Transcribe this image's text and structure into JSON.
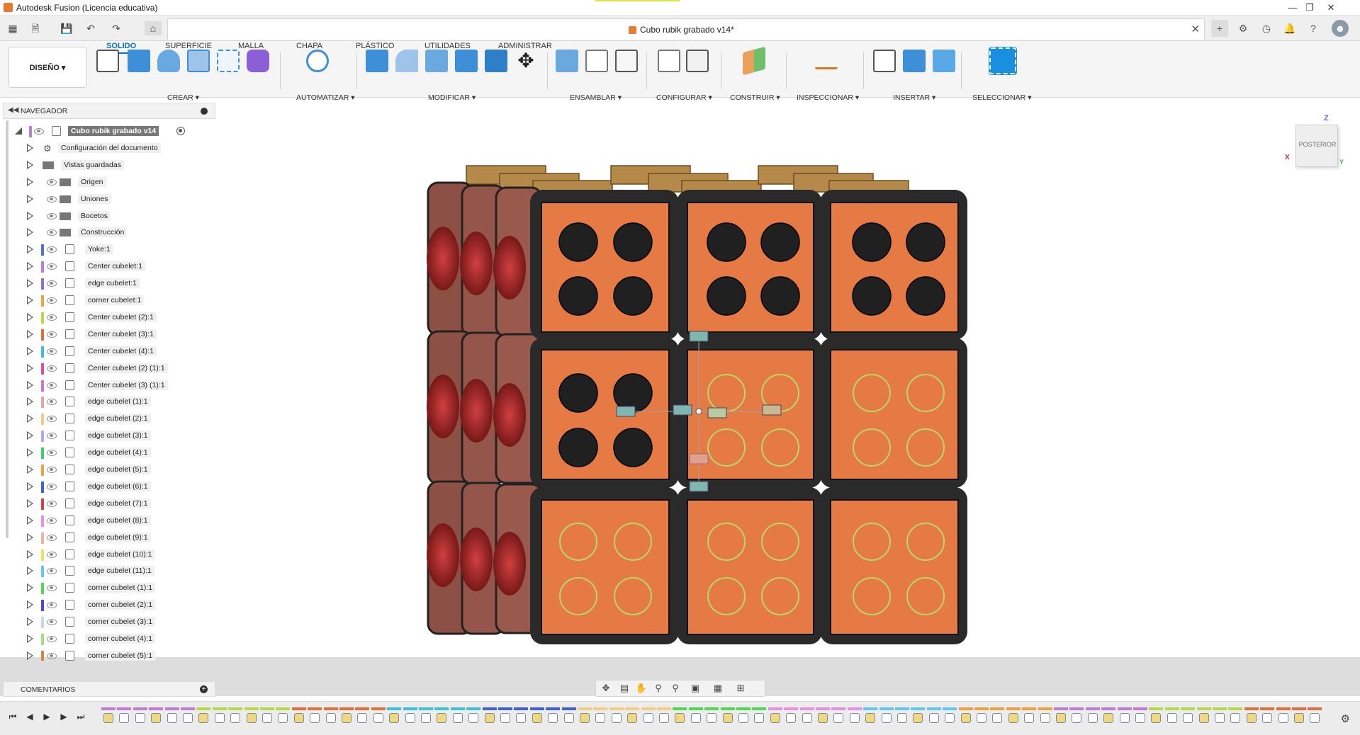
{
  "app": {
    "title": "Autodesk Fusion (Licencia educativa)"
  },
  "document": {
    "tab_title": "Cubo rubik grabado v14*"
  },
  "ribbon": {
    "tabs": [
      "SOLIDO",
      "SUPERFICIE",
      "MALLA",
      "CHAPA",
      "PLÁSTICO",
      "UTILIDADES",
      "ADMINISTRAR"
    ],
    "active_tab": "SOLIDO",
    "workspace": "DISEÑO",
    "groups": [
      "CREAR",
      "AUTOMATIZAR",
      "MODIFICAR",
      "ENSAMBLAR",
      "CONFIGURAR",
      "CONSTRUIR",
      "INSPECCIONAR",
      "INSERTAR",
      "SELECCIONAR"
    ]
  },
  "navigator": {
    "header": "NAVEGADOR",
    "root": "Cubo rubik grabado v14",
    "items": [
      {
        "label": "Configuración del documento",
        "type": "settings",
        "color": ""
      },
      {
        "label": "Vistas guardadas",
        "type": "folder-plain",
        "color": ""
      },
      {
        "label": "Origen",
        "type": "folder",
        "color": ""
      },
      {
        "label": "Uniones",
        "type": "folder",
        "color": ""
      },
      {
        "label": "Bocetos",
        "type": "folder",
        "color": ""
      },
      {
        "label": "Construcción",
        "type": "folder",
        "color": ""
      },
      {
        "label": "Yoke:1",
        "type": "component",
        "color": "#4a72d8"
      },
      {
        "label": "Center cubelet:1",
        "type": "component",
        "color": "#c07ad8"
      },
      {
        "label": "edge cubelet:1",
        "type": "component",
        "color": "#8f6fd8"
      },
      {
        "label": "corner cubelet:1",
        "type": "component",
        "color": "#f0a040"
      },
      {
        "label": "Center cubelet (2):1",
        "type": "component",
        "color": "#b8d84a"
      },
      {
        "label": "Center cubelet (3):1",
        "type": "component",
        "color": "#e0713a"
      },
      {
        "label": "Center cubelet (4):1",
        "type": "component",
        "color": "#3cc3d8"
      },
      {
        "label": "Center cubelet (2) (1):1",
        "type": "component",
        "color": "#e04aa0"
      },
      {
        "label": "Center cubelet (3) (1):1",
        "type": "component",
        "color": "#d070d8"
      },
      {
        "label": "edge cubelet (1):1",
        "type": "component",
        "color": "#f0a0a0"
      },
      {
        "label": "edge cubelet (2):1",
        "type": "component",
        "color": "#f0d080"
      },
      {
        "label": "edge cubelet (3):1",
        "type": "component",
        "color": "#c0a0e8"
      },
      {
        "label": "edge cubelet (4):1",
        "type": "component",
        "color": "#3ad070"
      },
      {
        "label": "edge cubelet (5):1",
        "type": "component",
        "color": "#f0a040"
      },
      {
        "label": "edge cubelet (6):1",
        "type": "component",
        "color": "#4060d8"
      },
      {
        "label": "edge cubelet (7):1",
        "type": "component",
        "color": "#d84040"
      },
      {
        "label": "edge cubelet (8):1",
        "type": "component",
        "color": "#e890e0"
      },
      {
        "label": "edge cubelet (9):1",
        "type": "component",
        "color": "#f0b0a0"
      },
      {
        "label": "edge cubelet (10):1",
        "type": "component",
        "color": "#f0e060"
      },
      {
        "label": "edge cubelet (11):1",
        "type": "component",
        "color": "#60c8f0"
      },
      {
        "label": "corner cubelet (1):1",
        "type": "component",
        "color": "#50d850"
      },
      {
        "label": "corner cubelet (2):1",
        "type": "component",
        "color": "#6040d0"
      },
      {
        "label": "corner cubelet (3):1",
        "type": "component",
        "color": "#c0d8f0"
      },
      {
        "label": "corner cubelet (4):1",
        "type": "component",
        "color": "#a0e080"
      },
      {
        "label": "corner cubelet (5):1",
        "type": "component",
        "color": "#e08040"
      }
    ]
  },
  "comments": {
    "header": "COMENTARIOS"
  },
  "viewcube": {
    "face": "POSTERIOR",
    "z_label": "Z",
    "x_label": "X",
    "y_label": "Y"
  },
  "colors": {
    "accent": "#0b6fc5",
    "face_orange": "#e57a45",
    "tile_black": "#1e1e1e",
    "ring_green": "#b8d66a"
  },
  "icons": {
    "quick_access": [
      "grid-icon",
      "file-icon",
      "save-icon",
      "undo-icon",
      "redo-icon",
      "home-icon"
    ],
    "right_header": [
      "new-tab-icon",
      "extensions-icon",
      "job-status-icon",
      "notifications-icon",
      "help-icon",
      "profile-icon"
    ],
    "nav_bar": [
      "orbit-icon",
      "look-at-icon",
      "pan-icon",
      "zoom-icon",
      "fit-icon",
      "display-settings-icon",
      "grid-settings-icon",
      "viewports-icon"
    ],
    "timeline": [
      "go-start-icon",
      "step-back-icon",
      "play-icon",
      "step-forward-icon",
      "go-end-icon",
      "timeline-settings-icon"
    ]
  }
}
